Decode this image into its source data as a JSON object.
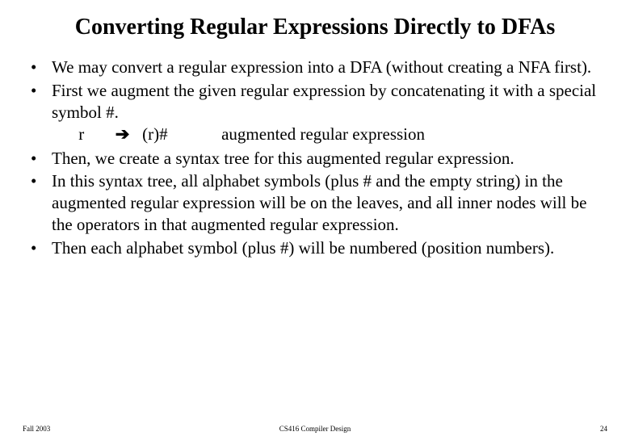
{
  "title": "Converting Regular Expressions Directly to DFAs",
  "bullets": [
    {
      "text": "We may convert a regular expression into a DFA (without creating a NFA first)."
    },
    {
      "text": "First we augment the given regular expression by concatenating it with a special symbol #.",
      "sub": {
        "lhs": "r",
        "arrow": "➔",
        "rhs": "(r)#",
        "note": "augmented regular expression"
      }
    },
    {
      "text": "Then, we create a syntax tree for this augmented regular expression."
    },
    {
      "text": "In this syntax tree, all alphabet symbols (plus # and the empty string) in the augmented regular expression will be on the leaves, and all inner nodes will be the operators in that augmented regular expression."
    },
    {
      "text": "Then each alphabet symbol (plus #) will  be numbered (position numbers)."
    }
  ],
  "footer": {
    "left": "Fall 2003",
    "center": "CS416 Compiler Design",
    "right": "24"
  }
}
